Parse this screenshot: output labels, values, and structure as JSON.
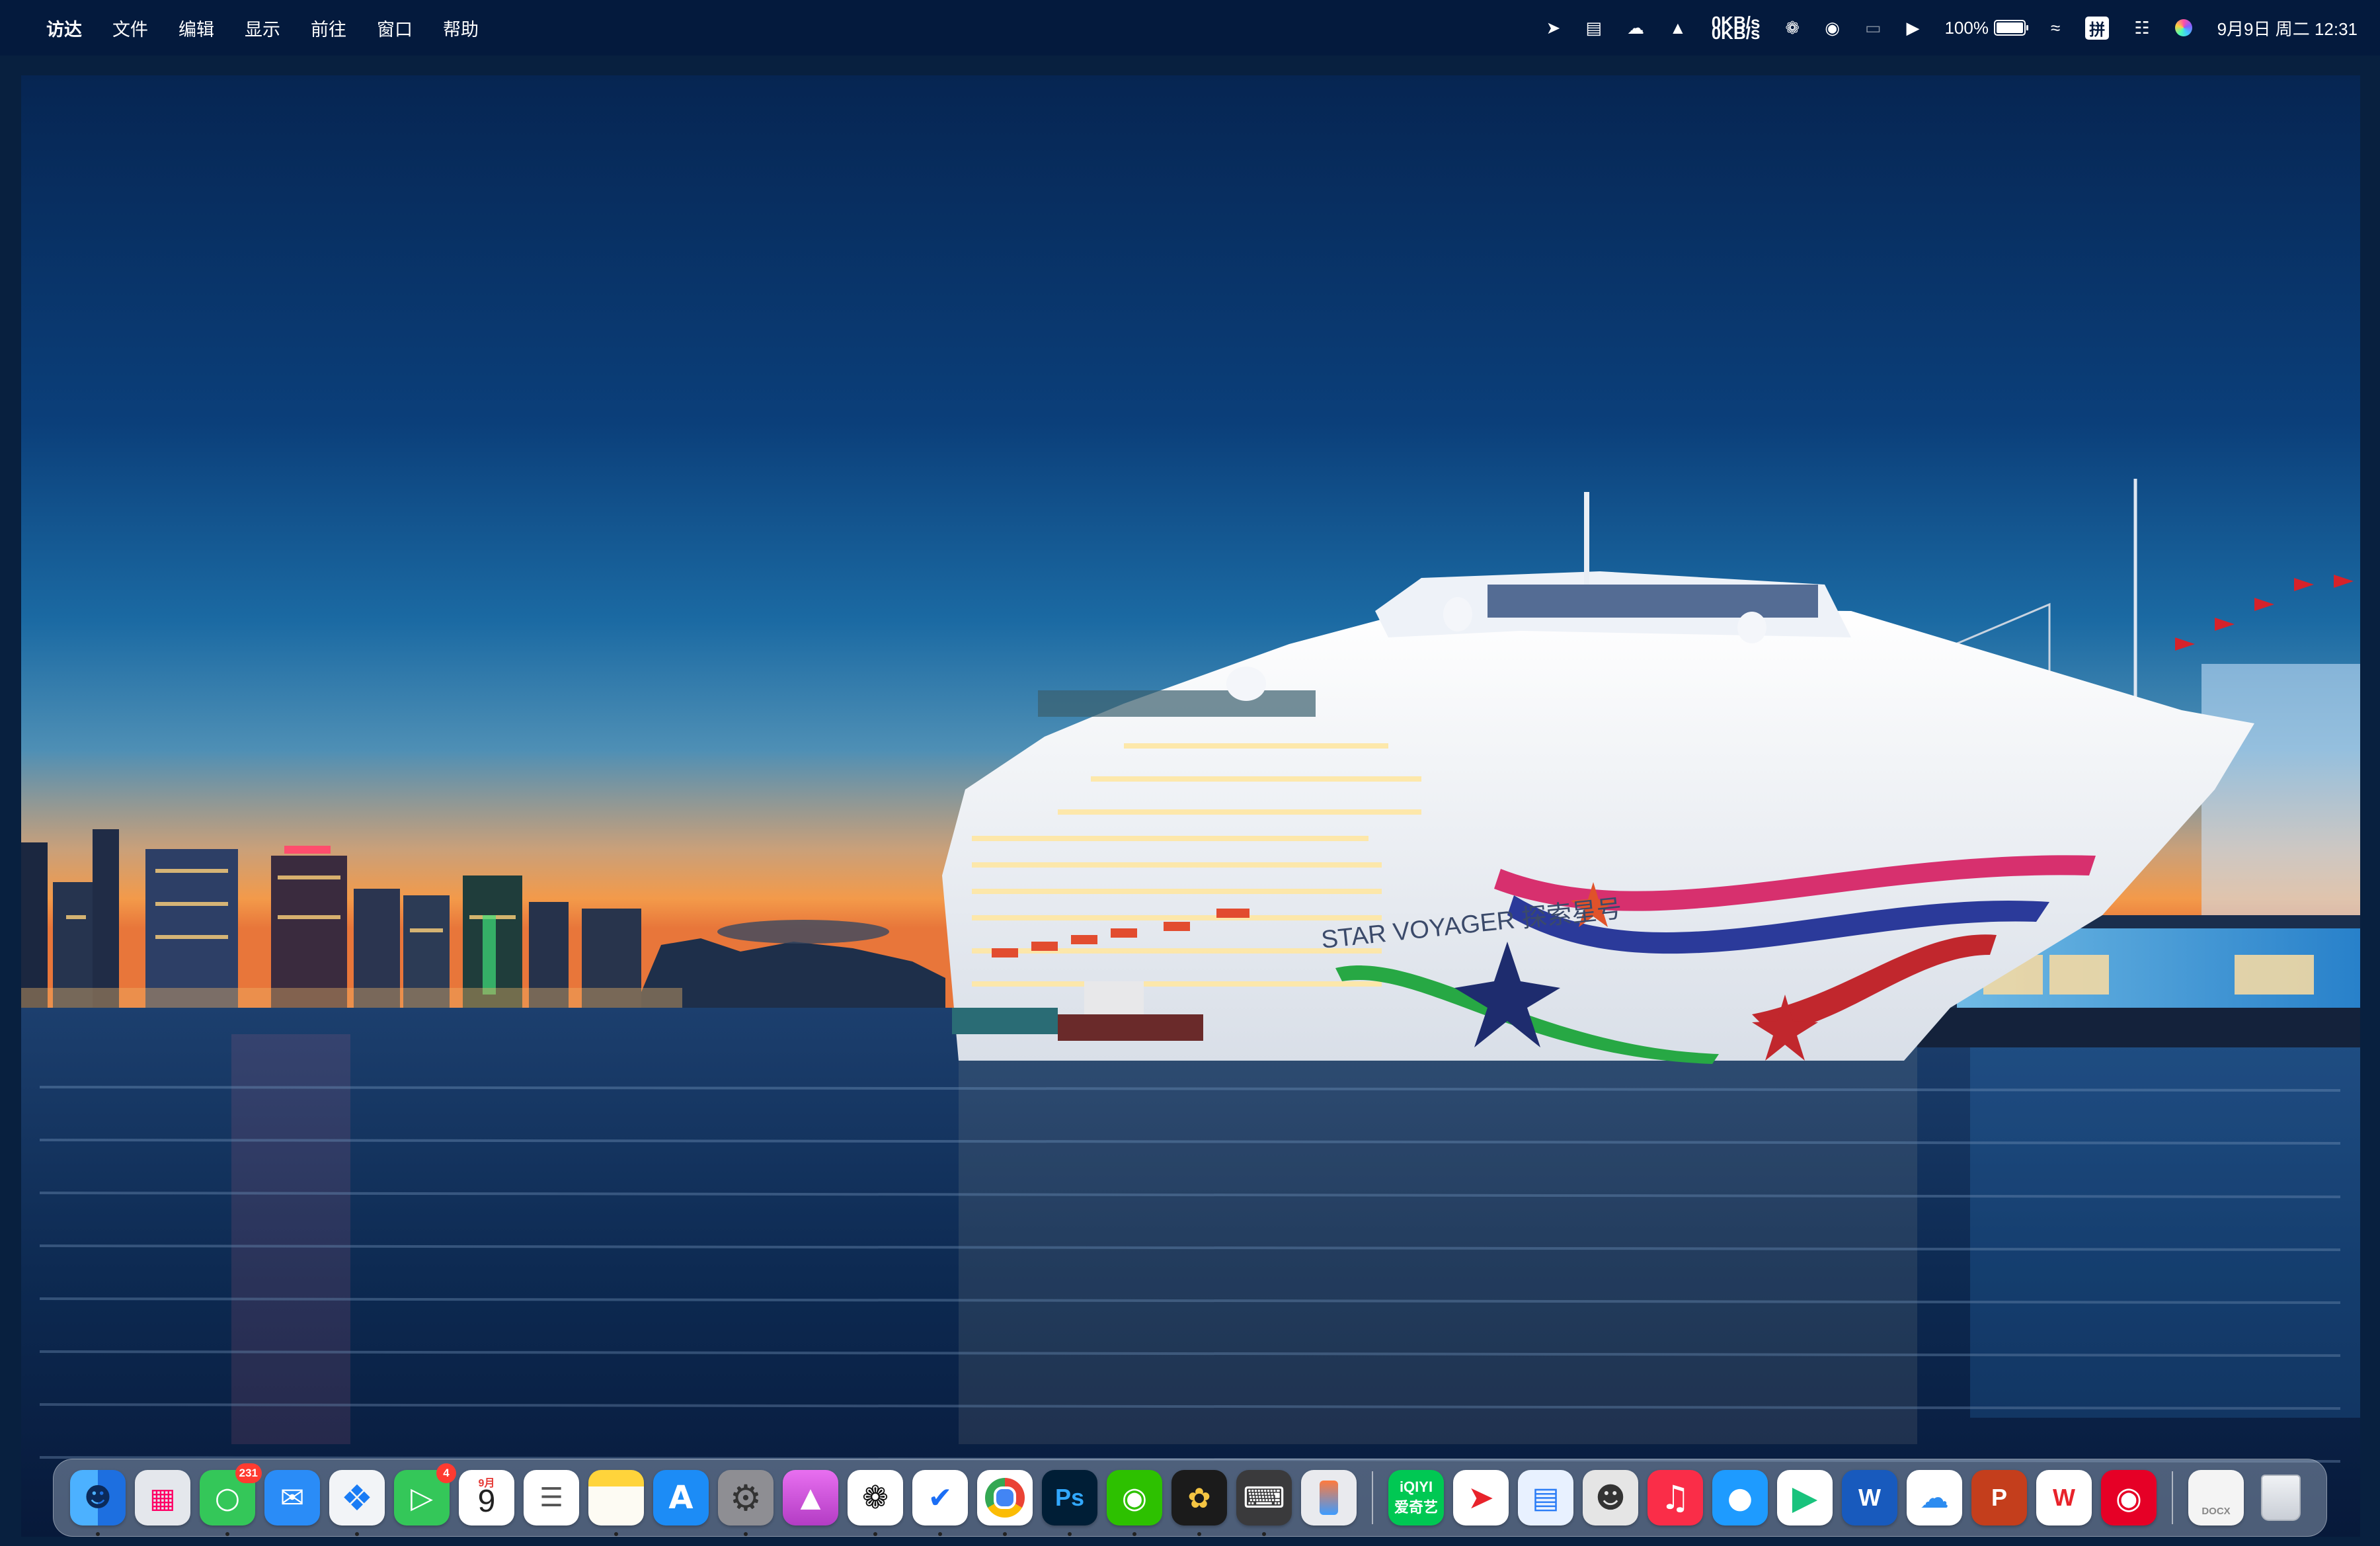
{
  "menubar": {
    "apple_icon": "apple-logo-icon",
    "app_name": "访达",
    "menus": [
      "文件",
      "编辑",
      "显示",
      "前往",
      "窗口",
      "帮助"
    ],
    "status": {
      "netspeed_up": "0KB/s",
      "netspeed_down": "0KB/s",
      "battery_percent": "100%",
      "input_method": "拼",
      "date_time": "9月9日 周二 12:31"
    }
  },
  "wallpaper": {
    "ship_name_text": "STAR VOYAGER 探索星号"
  },
  "dock": {
    "apps": [
      {
        "name": "Finder",
        "icon": "finder-icon",
        "color": "#1f8ef1",
        "running": true
      },
      {
        "name": "Launchpad",
        "icon": "launchpad-icon",
        "color": "#d9dde3",
        "running": false
      },
      {
        "name": "Messages",
        "icon": "messages-icon",
        "color": "#34c759",
        "badge": "231",
        "running": true
      },
      {
        "name": "Mail",
        "icon": "mail-icon",
        "color": "#2a8cf7",
        "running": false
      },
      {
        "name": "Safari",
        "icon": "safari-icon",
        "color": "#1a7cf5",
        "running": true
      },
      {
        "name": "FaceTime",
        "icon": "facetime-icon",
        "color": "#34c759",
        "badge": "4",
        "running": false
      },
      {
        "name": "Calendar",
        "icon": "calendar-icon",
        "color": "#ffffff",
        "month": "9月",
        "day": "9",
        "running": false
      },
      {
        "name": "Reminders",
        "icon": "reminders-icon",
        "color": "#ffffff",
        "running": false
      },
      {
        "name": "Notes",
        "icon": "notes-icon",
        "color": "#ffd43b",
        "running": true
      },
      {
        "name": "App Store",
        "icon": "app-store-icon",
        "color": "#1c8cf6",
        "running": false
      },
      {
        "name": "System Settings",
        "icon": "settings-gear-icon",
        "color": "#8e8e93",
        "running": true
      },
      {
        "name": "Creative App",
        "icon": "magenta-app-icon",
        "color": "#d64fe0",
        "running": false
      },
      {
        "name": "ChatGPT",
        "icon": "chatgpt-icon",
        "color": "#ffffff",
        "running": true
      },
      {
        "name": "Lark",
        "icon": "swoosh-app-icon",
        "color": "#ffffff",
        "running": true
      },
      {
        "name": "Chrome",
        "icon": "chrome-icon",
        "color": "#ffffff",
        "running": true
      },
      {
        "name": "Photoshop",
        "icon": "photoshop-icon",
        "color": "#001e36",
        "label": "Ps",
        "running": true
      },
      {
        "name": "WeChat",
        "icon": "wechat-icon",
        "color": "#2dc100",
        "running": true
      },
      {
        "name": "DaVinci Resolve",
        "icon": "davinci-resolve-icon",
        "color": "#1b1b1b",
        "running": true
      },
      {
        "name": "Keyboard Utility",
        "icon": "keyboard-app-icon",
        "color": "#3a3a3c",
        "running": true
      },
      {
        "name": "iPhone Mirroring",
        "icon": "iphone-mirroring-icon",
        "color": "#e9eaee",
        "running": false
      },
      {
        "name": "iQIYI",
        "icon": "iqiyi-icon",
        "color": "#00c853",
        "label": "iQIYI",
        "label2": "爱奇艺",
        "running": false
      },
      {
        "name": "Ark App",
        "icon": "red-arrow-app-icon",
        "color": "#ffffff",
        "running": false
      },
      {
        "name": "Screen App",
        "icon": "blue-screen-app-icon",
        "color": "#e8f1ff",
        "running": false
      },
      {
        "name": "Robot App",
        "icon": "robot-app-icon",
        "color": "#e5e5e5",
        "running": false
      },
      {
        "name": "Music",
        "icon": "music-icon",
        "color": "#fa2d48",
        "running": false
      },
      {
        "name": "QQ",
        "icon": "qq-penguin-icon",
        "color": "#1e9bff",
        "running": false
      },
      {
        "name": "Video Player",
        "icon": "play-app-icon",
        "color": "#ffffff",
        "running": false
      },
      {
        "name": "Word",
        "icon": "word-icon",
        "color": "#185abd",
        "label": "W",
        "running": false
      },
      {
        "name": "Baidu Netdisk",
        "icon": "netdisk-icon",
        "color": "#ffffff",
        "running": false
      },
      {
        "name": "PowerPoint",
        "icon": "powerpoint-icon",
        "color": "#c43e1c",
        "label": "P",
        "running": false
      },
      {
        "name": "WPS",
        "icon": "wps-icon",
        "color": "#ffffff",
        "label": "W",
        "running": false
      },
      {
        "name": "NetEase Music",
        "icon": "netease-music-icon",
        "color": "#e60026",
        "running": false
      }
    ],
    "trailing": [
      {
        "name": "Document",
        "icon": "document-stack-icon",
        "label": "DOCX"
      },
      {
        "name": "Trash",
        "icon": "trash-icon"
      }
    ]
  }
}
